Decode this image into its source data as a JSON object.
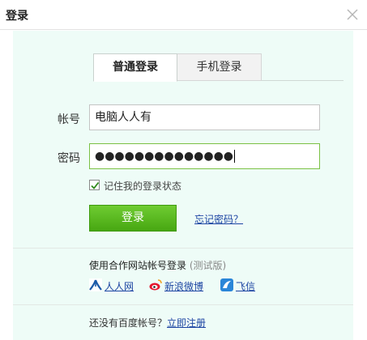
{
  "dialog": {
    "title": "登录"
  },
  "tabs": [
    {
      "label": "普通登录",
      "active": true
    },
    {
      "label": "手机登录",
      "active": false
    }
  ],
  "form": {
    "account_label": "帐号",
    "account_value": "电脑人人有",
    "password_label": "密码",
    "password_value": "●●●●●●●●●●●●●●",
    "remember_label": "记住我的登录状态",
    "remember_checked": true,
    "login_button": "登录",
    "forgot_link": "忘记密码？"
  },
  "partners": {
    "title": "使用合作网站帐号登录",
    "note": "(测试版)",
    "items": [
      {
        "label": "人人网",
        "icon": "renren-icon"
      },
      {
        "label": "新浪微博",
        "icon": "sina-weibo-icon"
      },
      {
        "label": "飞信",
        "icon": "fetion-icon"
      }
    ]
  },
  "register": {
    "prompt": "还没有百度帐号？",
    "link": "立即注册"
  },
  "colors": {
    "content_bg": "#eefcf7",
    "button_green": "#5bbb22",
    "link_blue": "#1d45a3",
    "focus_green": "#7bc144"
  }
}
